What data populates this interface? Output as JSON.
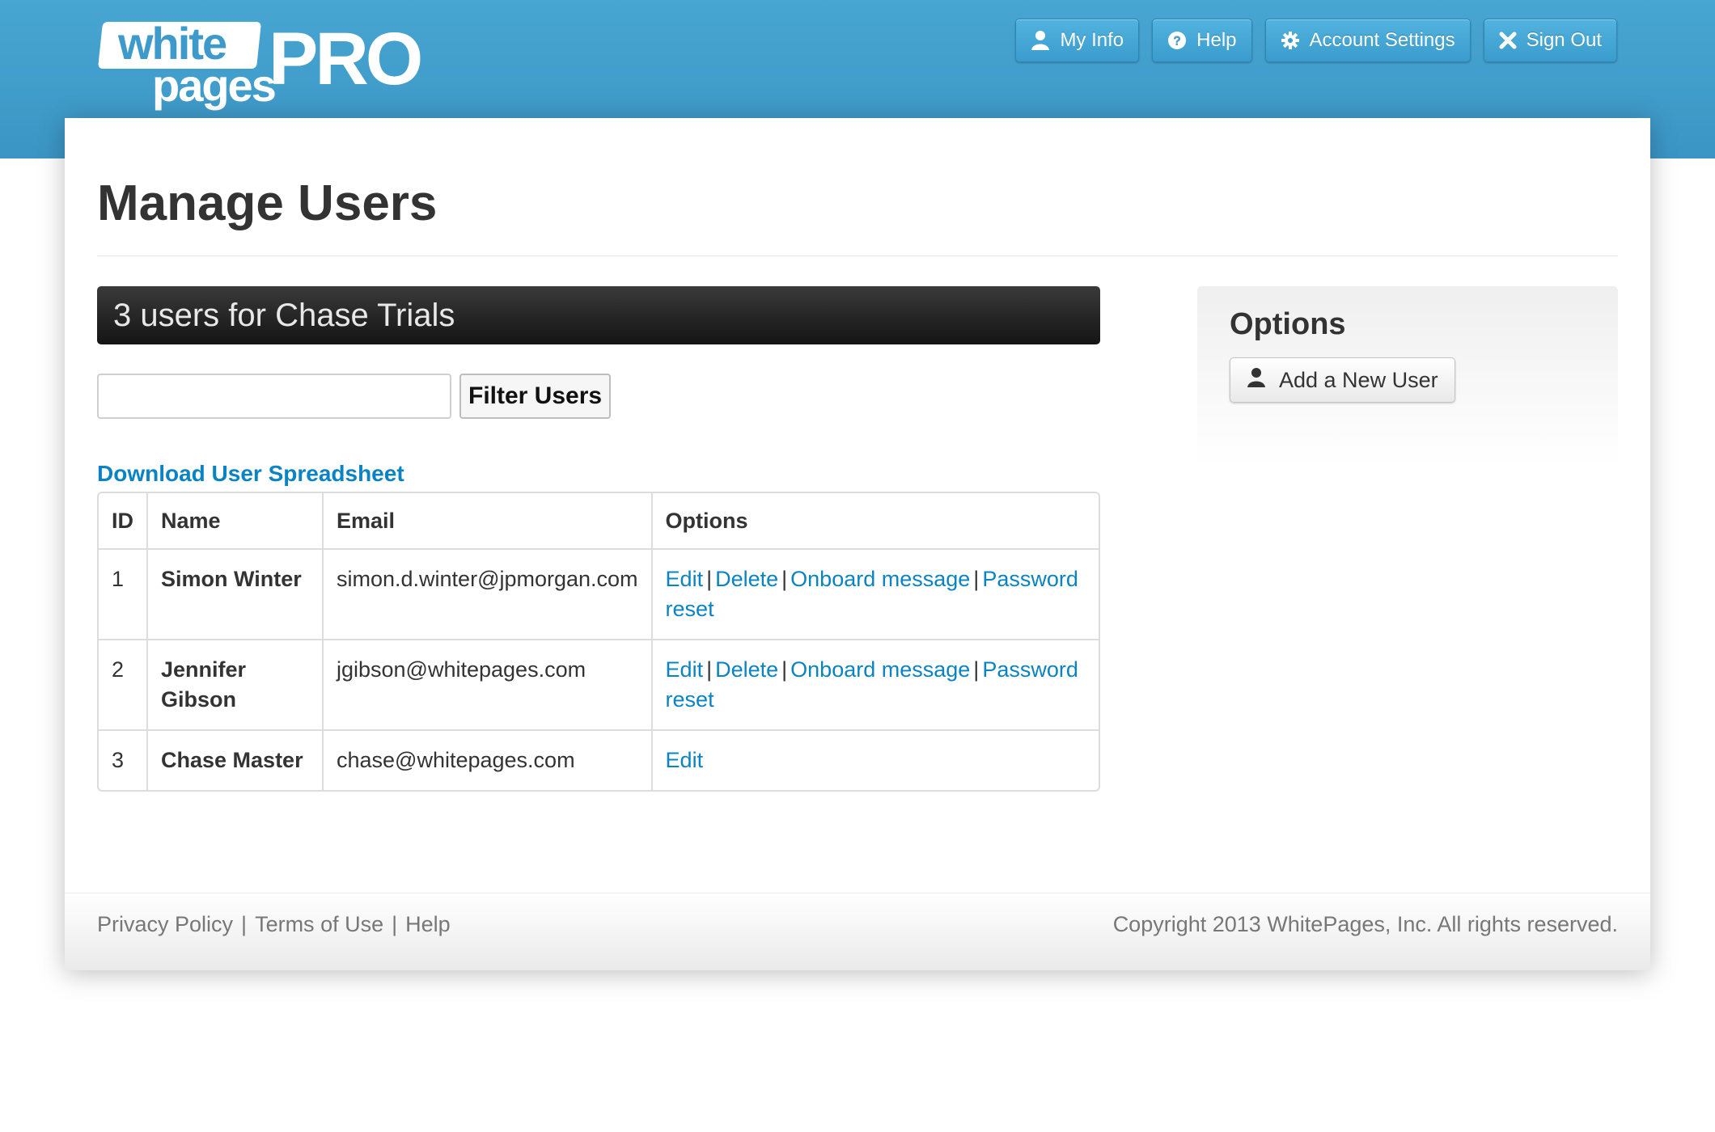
{
  "brand": {
    "logo_top": "white",
    "logo_bottom": "pages",
    "logo_pro": "PRO"
  },
  "top_nav": {
    "my_info": "My Info",
    "help": "Help",
    "account_settings": "Account Settings",
    "sign_out": "Sign Out"
  },
  "page": {
    "title": "Manage Users"
  },
  "users_section": {
    "header": "3 users for Chase Trials",
    "filter_value": "",
    "filter_button": "Filter Users",
    "download_link": "Download User Spreadsheet"
  },
  "table": {
    "headers": {
      "id": "ID",
      "name": "Name",
      "email": "Email",
      "options": "Options"
    },
    "rows": [
      {
        "id": "1",
        "name": "Simon Winter",
        "email": "simon.d.winter@jpmorgan.com",
        "edit": "Edit",
        "delete": "Delete",
        "onboard": "Onboard message",
        "reset": "Password reset"
      },
      {
        "id": "2",
        "name": "Jennifer Gibson",
        "email": "jgibson@whitepages.com",
        "edit": "Edit",
        "delete": "Delete",
        "onboard": "Onboard message",
        "reset": "Password reset"
      },
      {
        "id": "3",
        "name": "Chase Master",
        "email": "chase@whitepages.com",
        "edit": "Edit"
      }
    ],
    "separator": "|"
  },
  "options_panel": {
    "title": "Options",
    "add_user": "Add a New User"
  },
  "footer": {
    "privacy": "Privacy Policy",
    "terms": "Terms of Use",
    "help": "Help",
    "separator": "|",
    "copyright": "Copyright 2013 WhitePages, Inc. All rights reserved."
  },
  "colors": {
    "header_blue": "#48a6d2",
    "link_blue": "#0a83c4",
    "dark_header": "#1e1e1e"
  },
  "icons": {
    "my_info": "user-icon",
    "help": "question-circle-icon",
    "account_settings": "gear-icon",
    "sign_out": "close-icon",
    "add_user": "user-icon"
  }
}
